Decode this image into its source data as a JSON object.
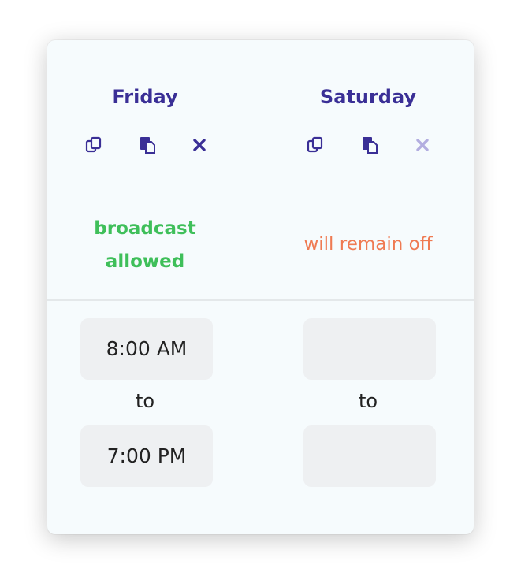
{
  "days": [
    {
      "name": "Friday",
      "status": "broadcast allowed",
      "status_color": "#3fbf5a",
      "start_time": "8:00 AM",
      "end_time": "7:00 PM",
      "to_label": "to",
      "icons": [
        "copy-icon",
        "paste-icon",
        "clear-icon"
      ],
      "clear_enabled": true
    },
    {
      "name": "Saturday",
      "status": "will remain off",
      "status_color": "#ef7a52",
      "start_time": "",
      "end_time": "",
      "to_label": "to",
      "icons": [
        "copy-icon",
        "paste-icon",
        "clear-icon"
      ],
      "clear_enabled": false
    }
  ],
  "colors": {
    "accent": "#3a2f96",
    "allowed": "#3fbf5a",
    "off": "#ef7a52",
    "disabled_icon": "#b3aee0"
  }
}
